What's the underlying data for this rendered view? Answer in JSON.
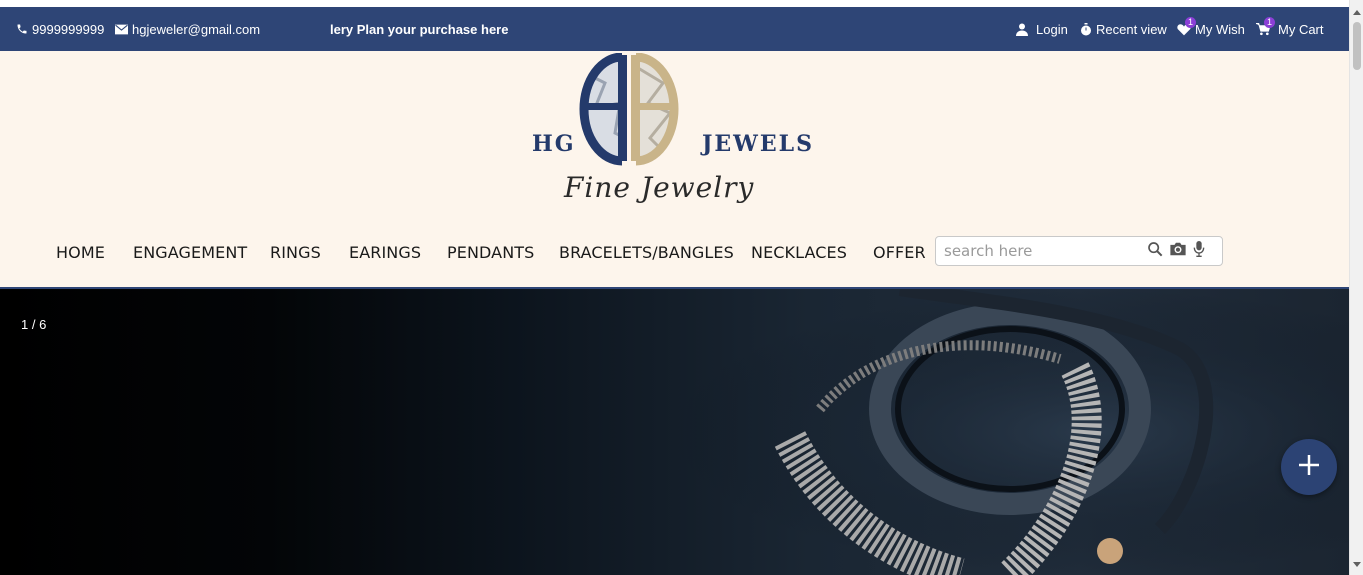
{
  "topbar": {
    "phone": "9999999999",
    "email": "hgjeweler@gmail.com",
    "marquee": "lery Plan your purchase here",
    "login": "Login",
    "recent": "Recent view",
    "wish": "My Wish",
    "wish_count": "1",
    "cart": "My Cart",
    "cart_count": "1",
    "icons": [
      "phone-icon",
      "mail-icon",
      "user-icon",
      "stopwatch-icon",
      "heart-icon",
      "cart-icon"
    ]
  },
  "logo": {
    "left_text": "HG",
    "right_text": "JEWELS",
    "tagline": "Fine Jewelry"
  },
  "nav": {
    "items": [
      "HOME",
      "ENGAGEMENT",
      "RINGS",
      "EARINGS",
      "PENDANTS",
      "BRACELETS/BANGLES",
      "NECKLACES",
      "OFFER"
    ]
  },
  "search": {
    "placeholder": "search here",
    "icons": [
      "search-icon",
      "camera-icon",
      "microphone-icon"
    ]
  },
  "hero": {
    "counter": "1 / 6"
  },
  "fab": {
    "icon": "plus-icon"
  },
  "colors": {
    "topbar": "#2e4576",
    "header_bg": "#fdf5ec",
    "brand_blue": "#243a6b",
    "brand_gold": "#c9b489",
    "badge": "#8b3fd6"
  }
}
